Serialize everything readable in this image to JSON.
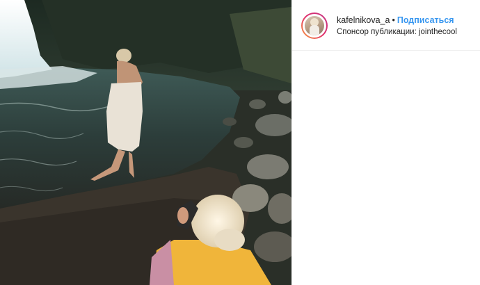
{
  "post": {
    "image_alt": "",
    "header": {
      "username": "kafelnikova_a",
      "separator": "•",
      "follow_label": "Подписаться",
      "sponsor_prefix": "Спонсор публикации: ",
      "sponsor_name": "jointhecool"
    }
  },
  "colors": {
    "link": "#3897f0",
    "text": "#262626",
    "divider": "#efefef"
  },
  "icons": {
    "avatar": "profile-photo"
  }
}
